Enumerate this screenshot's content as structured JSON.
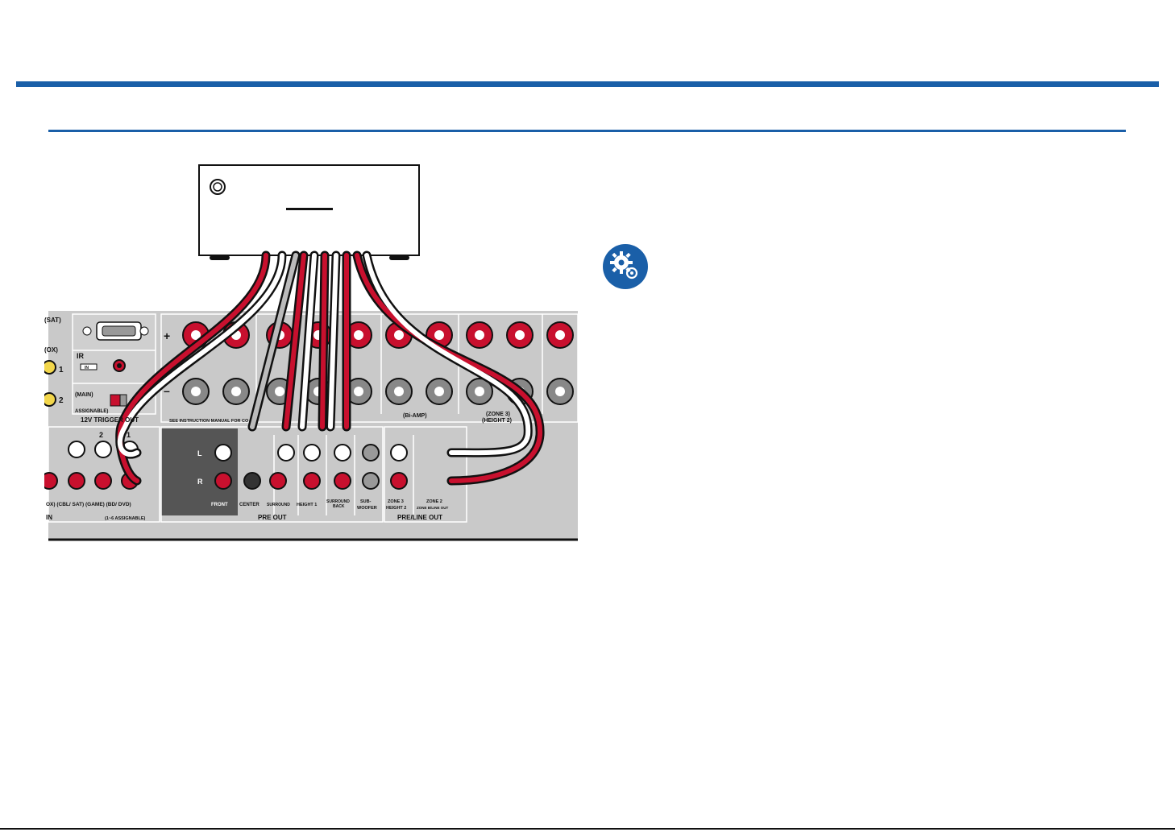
{
  "panel": {
    "frag_sat": "(SAT)",
    "frag_ox": "(OX)",
    "in_num_1": "1",
    "in_num_2": "2",
    "frag_main": "(MAIN)",
    "frag_assignable": "ASSIGNABLE)",
    "trigger_label": "12V TRIGGER OUT",
    "ir_label": "IR",
    "ir_in": "IN",
    "jack_2": "2",
    "jack_1": "1",
    "input_labels": "OX)  (CBL/ SAT)  (GAME)  (BD/ DVD)",
    "in_label": "IN",
    "assignable_range": "(1~6 ASSIGNABLE)",
    "plus": "+",
    "minus": "–",
    "see_manual": "SEE INSTRUCTION MANUAL FOR CO",
    "bi_amp": "(Bi-AMP)",
    "zone3_top": "(ZONE 3)",
    "height2_top": "(HEIGHT 2)",
    "L": "L",
    "R": "R",
    "front": "FRONT",
    "center": "CENTER",
    "surround": "SURROUND",
    "height1": "HEIGHT 1",
    "surround_back_1": "SURROUND",
    "surround_back_2": "BACK",
    "subwoofer_1": "SUB-",
    "subwoofer_2": "WOOFER",
    "zone3_bottom": "ZONE 3",
    "height2_bottom": "HEIGHT 2",
    "zone2_bottom": "ZONE 2",
    "zone2_sub": "ZONE B/LINE OUT",
    "pre_out": "PRE OUT",
    "pre_line_out": "PRE/LINE OUT"
  },
  "icons": {
    "settings": "gears-icon"
  },
  "colors": {
    "accent": "#1a5fa8",
    "cable_red": "#c8102e",
    "panel": "#c9c9c9"
  }
}
